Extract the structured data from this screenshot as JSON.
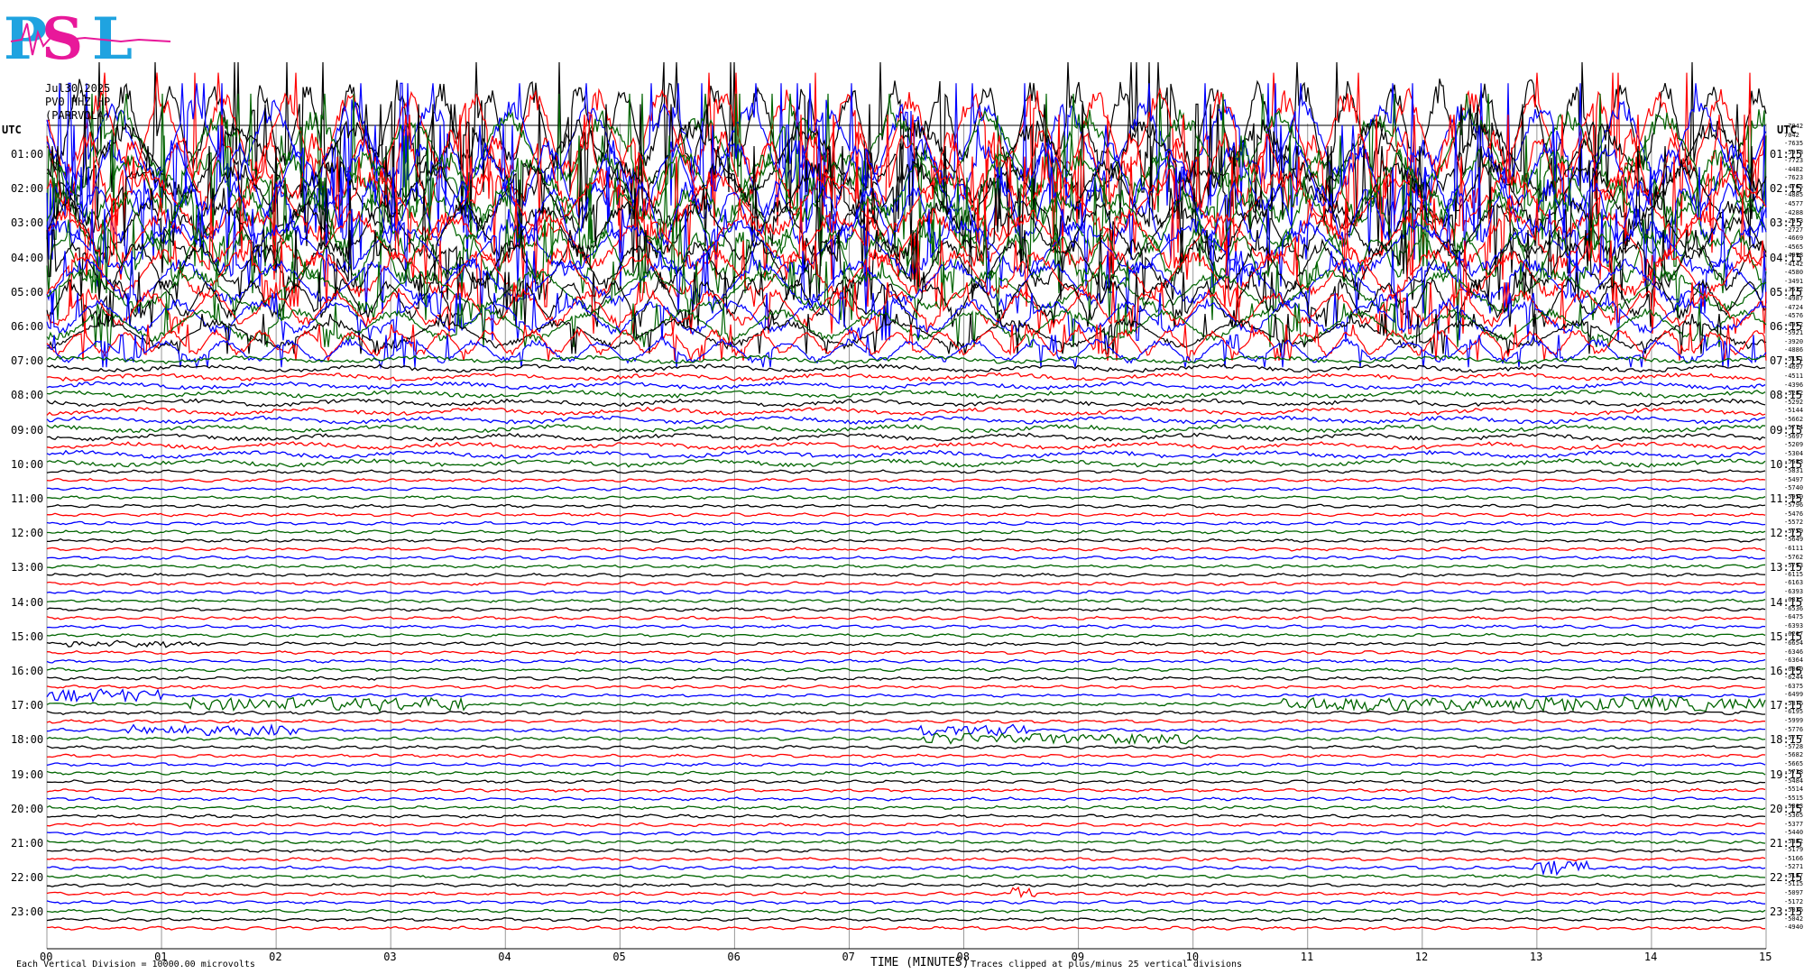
{
  "header": {
    "logo_text": "PSL",
    "date": "Jul30,2025",
    "station": "PV0 HHZ HP",
    "network": "(PARRVOLA)",
    "utc_left": "UTC",
    "utc_right": "UTC"
  },
  "footer": {
    "vertical_division": "Each Vertical Division = 10000.00 microvolts",
    "xlabel": "TIME (MINUTES)",
    "clip_note": "Traces clipped at plus/minus 25 vertical divisions"
  },
  "colors": {
    "black": "#000000",
    "red": "#ff0000",
    "blue": "#0000ff",
    "green": "#006400",
    "grid": "#999999"
  },
  "chart_data": {
    "type": "line",
    "title": "",
    "xlabel": "TIME (MINUTES)",
    "xlim": [
      0,
      15
    ],
    "x_ticks": [
      "00",
      "01",
      "02",
      "03",
      "04",
      "05",
      "06",
      "07",
      "08",
      "09",
      "10",
      "11",
      "12",
      "13",
      "14",
      "15"
    ],
    "left_hour_labels": [
      "01:00",
      "02:00",
      "03:00",
      "04:00",
      "05:00",
      "06:00",
      "07:00",
      "08:00",
      "09:00",
      "10:00",
      "11:00",
      "12:00",
      "13:00",
      "14:00",
      "15:00",
      "16:00",
      "17:00",
      "18:00",
      "19:00",
      "20:00",
      "21:00",
      "22:00",
      "23:00"
    ],
    "right_hour_labels": [
      "01:15",
      "02:15",
      "03:15",
      "04:15",
      "05:15",
      "06:15",
      "07:15",
      "08:15",
      "09:15",
      "10:15",
      "11:15",
      "12:15",
      "13:15",
      "14:15",
      "15:15",
      "16:15",
      "17:15",
      "18:15",
      "19:15",
      "20:15",
      "21:15",
      "22:15",
      "23:15"
    ],
    "trace_color_cycle": [
      "black",
      "red",
      "blue",
      "green"
    ],
    "trace_offsets": [
      "-7042",
      "7042",
      "-7635",
      "-5978",
      "-7723",
      "-4482",
      "-7623",
      "-4765",
      "-4885",
      "-4577",
      "-4288",
      "-2973",
      "-2727",
      "-4669",
      "-4565",
      "-4998",
      "-4142",
      "-4580",
      "-3491",
      "-3532",
      "-4987",
      "-4724",
      "-4576",
      "-4952",
      "-5921",
      "-3920",
      "-4886",
      "-5151",
      "-4697",
      "-4511",
      "-4396",
      "-5282",
      "-5292",
      "-5144",
      "-5662",
      "-5774",
      "-5697",
      "-5209",
      "-5304",
      "-5683",
      "-5831",
      "-5497",
      "-5740",
      "-5950",
      "-5796",
      "-5476",
      "-5572",
      "-5759",
      "-5649",
      "-6111",
      "-5762",
      "-5793",
      "-6115",
      "-6163",
      "-6393",
      "-6335",
      "-6536",
      "-6475",
      "-6393",
      "-6267",
      "-6654",
      "-6346",
      "-6364",
      "-6060",
      "-6244",
      "-6375",
      "-6499",
      "-5876",
      "-6195",
      "-5999",
      "-5776",
      "-5777",
      "-5728",
      "-5682",
      "-5665",
      "-5738",
      "-5484",
      "-5514",
      "-5515",
      "-5363",
      "-5365",
      "-5377",
      "-5440",
      "-5382",
      "-5179",
      "-5166",
      "-5271",
      "-5187",
      "-5115",
      "-5097",
      "-5172",
      "-5036",
      "-5042",
      "-4940"
    ]
  }
}
